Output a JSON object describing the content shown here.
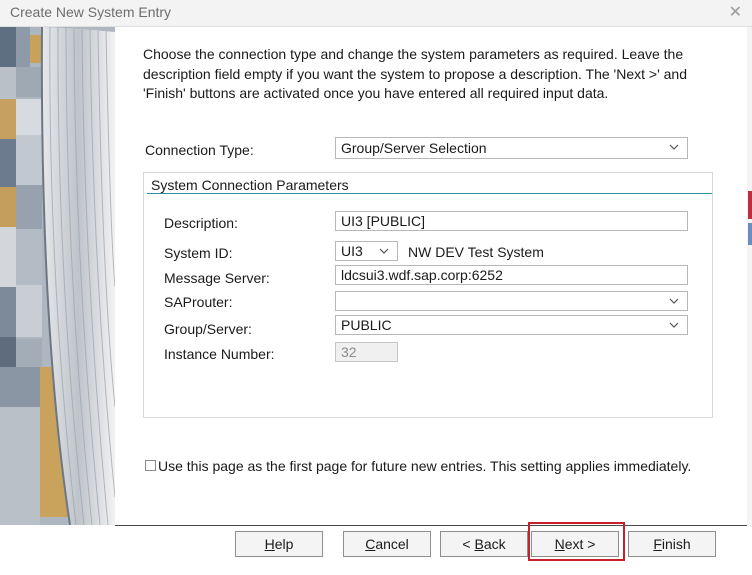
{
  "window": {
    "title": "Create New System Entry",
    "close_glyph": "✕"
  },
  "intro_text": "Choose the connection type and change the system parameters as required. Leave the description field empty if you want the system to propose a description. The 'Next >' and 'Finish' buttons are activated once you have entered all required input data.",
  "connection_type": {
    "label": "Connection Type:",
    "value": "Group/Server Selection"
  },
  "params": {
    "title": "System Connection Parameters",
    "description": {
      "label": "Description:",
      "value": "UI3 [PUBLIC]"
    },
    "system_id": {
      "label": "System ID:",
      "value": "UI3",
      "system_name": "NW DEV Test System"
    },
    "message_server": {
      "label": "Message Server:",
      "value": "ldcsui3.wdf.sap.corp:6252"
    },
    "saprouter": {
      "label": "SAProuter:",
      "value": ""
    },
    "group_server": {
      "label": "Group/Server:",
      "value": "PUBLIC"
    },
    "instance_number": {
      "label": "Instance Number:",
      "value": "32"
    }
  },
  "first_page_checkbox": {
    "checked": false,
    "label": "Use this page as the first page for future new entries. This setting applies immediately."
  },
  "buttons": {
    "help": {
      "mnemonic": "H",
      "rest": "elp"
    },
    "cancel": {
      "mnemonic": "C",
      "rest": "ancel"
    },
    "back": {
      "prefix": "< ",
      "mnemonic": "B",
      "rest": "ack"
    },
    "next": {
      "mnemonic": "N",
      "rest": "ext >",
      "highlighted": true
    },
    "finish": {
      "mnemonic": "F",
      "rest": "inish"
    }
  },
  "colors": {
    "highlight": "#c8202a",
    "group_rule": "#2d8ca0",
    "button_bg": "#f4f4f4"
  },
  "icons": {
    "dropdown": "chevron-down-icon",
    "close": "close-icon"
  }
}
